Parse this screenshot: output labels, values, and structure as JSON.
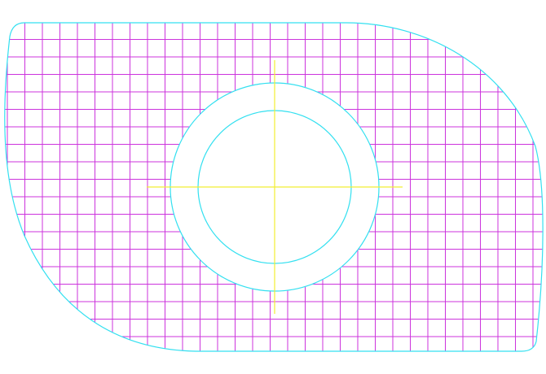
{
  "drawing": {
    "view": "hatched-plate-with-bore",
    "colors": {
      "background": "#ffffff",
      "outline": "#33e0f0",
      "hatch": "#cc33dd",
      "centerline": "#f2ee33"
    },
    "features": {
      "outer_profile": "plate-outline",
      "hatch_pattern": "square-grid",
      "annulus": "bore-ring",
      "centerlines": "crosshair"
    }
  }
}
